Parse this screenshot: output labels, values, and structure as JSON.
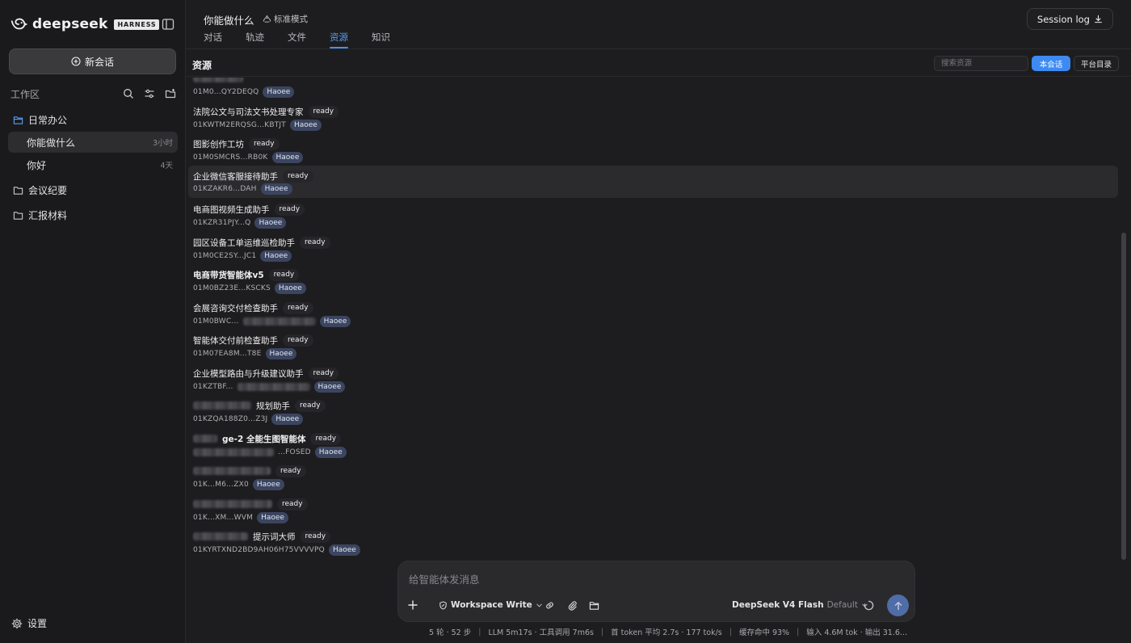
{
  "brand": {
    "name": "deepseek",
    "badge": "HARNESS"
  },
  "sidebar": {
    "new_chat_label": "新会话",
    "workspace_title": "工作区",
    "folders": [
      {
        "label": "日常办公",
        "open": true
      },
      {
        "label": "会议纪要",
        "open": false
      },
      {
        "label": "汇报材料",
        "open": false
      }
    ],
    "chats": [
      {
        "label": "你能做什么",
        "time": "3小时",
        "active": true
      },
      {
        "label": "你好",
        "time": "4天",
        "active": false
      }
    ],
    "settings_label": "设置"
  },
  "header": {
    "conversation_title": "你能做什么",
    "mode_label": "标准模式",
    "tabs": [
      {
        "label": "对话",
        "active": false
      },
      {
        "label": "轨迹",
        "active": false
      },
      {
        "label": "文件",
        "active": false
      },
      {
        "label": "资源",
        "active": true
      },
      {
        "label": "知识",
        "active": false
      }
    ],
    "session_log_label": "Session log"
  },
  "resources": {
    "title": "资源",
    "search_placeholder": "搜索资源",
    "btn_session": "本会话",
    "btn_platform": "平台目录",
    "items": [
      {
        "name": "",
        "status": "",
        "id": "01M0...QY2DEQQ",
        "owner": "Haoee"
      },
      {
        "name": "法院公文与司法文书处理专家",
        "status": "ready",
        "id": "01KWTM2ERQSG...KBTJT",
        "owner": "Haoee"
      },
      {
        "name": "图影创作工坊",
        "status": "ready",
        "id": "01M0SMCRS...RB0K",
        "owner": "Haoee"
      },
      {
        "name": "企业微信客服接待助手",
        "status": "ready",
        "id": "01KZAKR6...DAH",
        "owner": "Haoee"
      },
      {
        "name": "电商图视频生成助手",
        "status": "ready",
        "id": "01KZR31PJY...Q",
        "owner": "Haoee"
      },
      {
        "name": "园区设备工单运维巡检助手",
        "status": "ready",
        "id": "01M0CE2SY...JC1",
        "owner": "Haoee"
      },
      {
        "name": "电商带货智能体v5",
        "status": "ready",
        "id": "01M0BZ23E...KSCKS",
        "owner": "Haoee"
      },
      {
        "name": "会展咨询交付检查助手",
        "status": "ready",
        "id": "01M0BWC...",
        "owner": "Haoee"
      },
      {
        "name": "智能体交付前检查助手",
        "status": "ready",
        "id": "01M07EA8M...T8E",
        "owner": "Haoee"
      },
      {
        "name": "企业模型路由与升级建议助手",
        "status": "ready",
        "id": "01KZTBF...",
        "owner": "Haoee"
      },
      {
        "name": "规划助手",
        "status": "ready",
        "id": "01KZQA188Z0...Z3J",
        "owner": "Haoee"
      },
      {
        "name": "ge-2 全能生图智能体",
        "status": "ready",
        "id": "...FOSED",
        "owner": "Haoee"
      },
      {
        "name": "",
        "status": "ready",
        "id": "01K...M6...ZX0",
        "owner": "Haoee"
      },
      {
        "name": "",
        "status": "ready",
        "id": "01K...XM...WVM",
        "owner": "Haoee"
      },
      {
        "name": "提示词大师",
        "status": "ready",
        "id": "01KYRTXND2BD9AH06H75VVVVPQ",
        "owner": "Haoee"
      }
    ]
  },
  "composer": {
    "placeholder": "给智能体发消息",
    "mode_label": "Workspace Write",
    "model_name": "DeepSeek V4 Flash",
    "model_variant": "Default"
  },
  "statusbar": {
    "segments": [
      "5 轮 · 52 步",
      "LLM 5m17s · 工具调用 7m6s",
      "首 token 平均 2.7s · 177 tok/s",
      "缓存命中 93%",
      "输入 4.6M tok · 输出 31.6..."
    ]
  },
  "colors": {
    "accent": "#3d8af2",
    "tab_active": "#5a9cf0",
    "owner_badge": "#3b4560",
    "send_button": "#4f6da6"
  }
}
